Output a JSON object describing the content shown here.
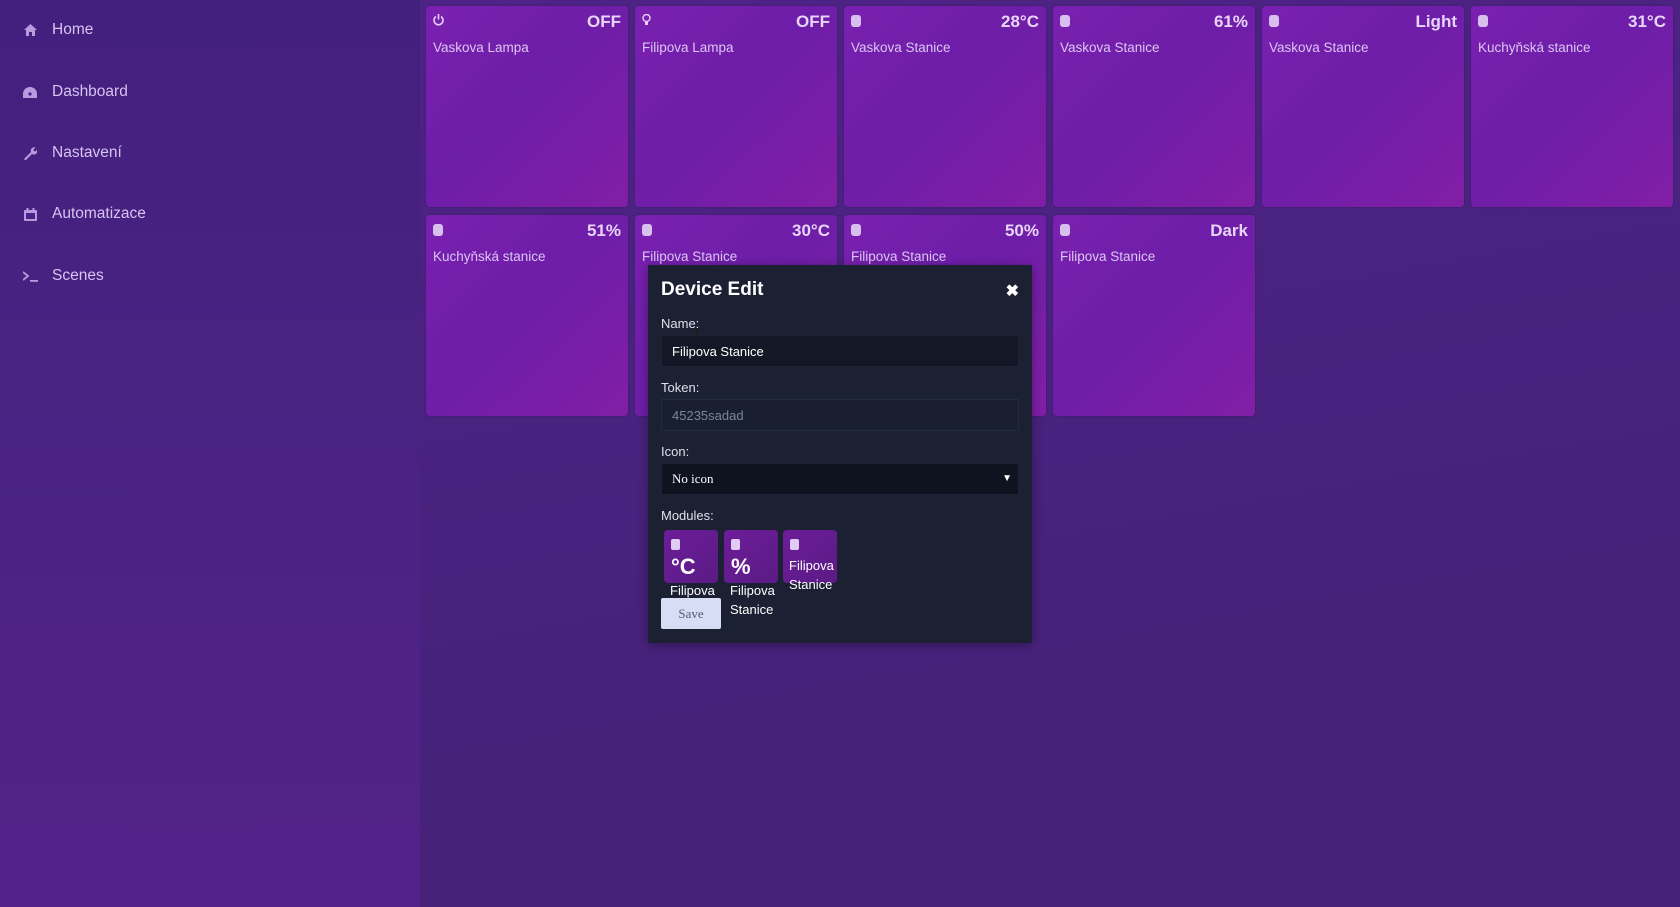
{
  "sidebar": {
    "items": [
      {
        "label": "Home",
        "icon": "home-icon"
      },
      {
        "label": "Dashboard",
        "icon": "gauge-icon"
      },
      {
        "label": "Nastavení",
        "icon": "wrench-icon"
      },
      {
        "label": "Automatizace",
        "icon": "calendar-icon"
      },
      {
        "label": "Scenes",
        "icon": "terminal-icon"
      }
    ]
  },
  "tiles": [
    {
      "icon": "power-icon",
      "value": "OFF",
      "name": "Vaskova Lampa"
    },
    {
      "icon": "bulb-icon",
      "value": "OFF",
      "name": "Filipova Lampa"
    },
    {
      "icon": "chip-icon",
      "value": "28°C",
      "name": "Vaskova Stanice"
    },
    {
      "icon": "chip-icon",
      "value": "61%",
      "name": "Vaskova Stanice"
    },
    {
      "icon": "chip-icon",
      "value": "Light",
      "name": "Vaskova Stanice"
    },
    {
      "icon": "chip-icon",
      "value": "31°C",
      "name": "Kuchyňská stanice"
    },
    {
      "icon": "chip-icon",
      "value": "51%",
      "name": "Kuchyňská stanice"
    },
    {
      "icon": "chip-icon",
      "value": "30°C",
      "name": "Filipova Stanice"
    },
    {
      "icon": "chip-icon",
      "value": "50%",
      "name": "Filipova Stanice"
    },
    {
      "icon": "chip-icon",
      "value": "Dark",
      "name": "Filipova Stanice"
    }
  ],
  "modal": {
    "title": "Device Edit",
    "close_glyph": "✖",
    "name_label": "Name:",
    "name_value": "Filipova Stanice",
    "token_label": "Token:",
    "token_placeholder": "45235sadad",
    "icon_label": "Icon:",
    "icon_selected": "No icon",
    "modules_label": "Modules:",
    "modules": [
      {
        "symbol": "°C",
        "caption": "Filipova"
      },
      {
        "symbol": "%",
        "caption": "Filipova\nStanice"
      },
      {
        "symbol": "",
        "caption": "Filipova\nStanice"
      }
    ],
    "save_label": "Save"
  },
  "colors": {
    "background": "#4a2388",
    "tile": "#7a20b0",
    "modal": "#1c2033",
    "save_button": "#d8ddf6"
  }
}
